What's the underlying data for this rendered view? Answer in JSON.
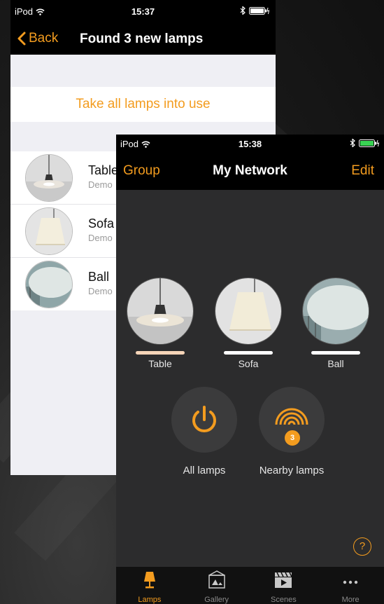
{
  "screen1": {
    "status": {
      "carrier": "iPod",
      "time": "15:37"
    },
    "nav": {
      "back_label": "Back",
      "title": "Found 3 new lamps"
    },
    "take_all_label": "Take all lamps into use",
    "lamps": [
      {
        "name": "Table",
        "subtitle": "Demo"
      },
      {
        "name": "Sofa",
        "subtitle": "Demo"
      },
      {
        "name": "Ball",
        "subtitle": "Demo"
      }
    ]
  },
  "screen2": {
    "status": {
      "carrier": "iPod",
      "time": "15:38"
    },
    "nav": {
      "left_label": "Group",
      "title": "My Network",
      "right_label": "Edit"
    },
    "lamps": [
      {
        "name": "Table"
      },
      {
        "name": "Sofa"
      },
      {
        "name": "Ball"
      }
    ],
    "actions": {
      "all_lamps_label": "All lamps",
      "nearby_lamps_label": "Nearby lamps",
      "nearby_count": "3"
    },
    "help_label": "?",
    "tabs": [
      {
        "label": "Lamps",
        "icon": "lamp-icon",
        "active": true
      },
      {
        "label": "Gallery",
        "icon": "gallery-icon",
        "active": false
      },
      {
        "label": "Scenes",
        "icon": "clapperboard-icon",
        "active": false
      },
      {
        "label": "More",
        "icon": "more-dots-icon",
        "active": false
      }
    ]
  },
  "colors": {
    "accent": "#f39c1f",
    "dark_bg": "#2c2c2d",
    "light_bg": "#efeff4"
  }
}
